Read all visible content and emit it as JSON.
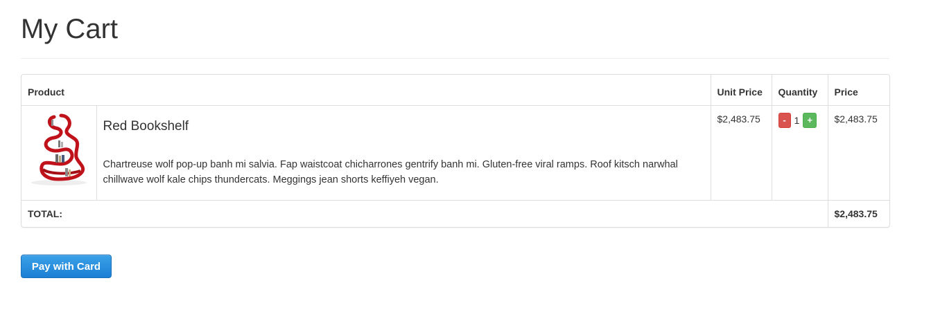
{
  "page": {
    "title": "My Cart"
  },
  "table": {
    "headers": {
      "product": "Product",
      "unit_price": "Unit Price",
      "quantity": "Quantity",
      "price": "Price"
    },
    "items": [
      {
        "image_icon": "red-bookshelf-image",
        "name": "Red Bookshelf",
        "description": "Chartreuse wolf pop-up banh mi salvia. Fap waistcoat chicharrones gentrify banh mi. Gluten-free viral ramps. Roof kitsch narwhal chillwave wolf kale chips thundercats. Meggings jean shorts keffiyeh vegan.",
        "unit_price": "$2,483.75",
        "quantity": "1",
        "decrement_label": "-",
        "increment_label": "+",
        "price": "$2,483.75"
      }
    ],
    "total_label": "TOTAL:",
    "total_value": "$2,483.75"
  },
  "actions": {
    "pay_label": "Pay with Card"
  },
  "colors": {
    "decrement": "#d9534f",
    "increment": "#5cb85c",
    "pay_button": "#2a8fdf",
    "product_accent": "#c0121a"
  }
}
